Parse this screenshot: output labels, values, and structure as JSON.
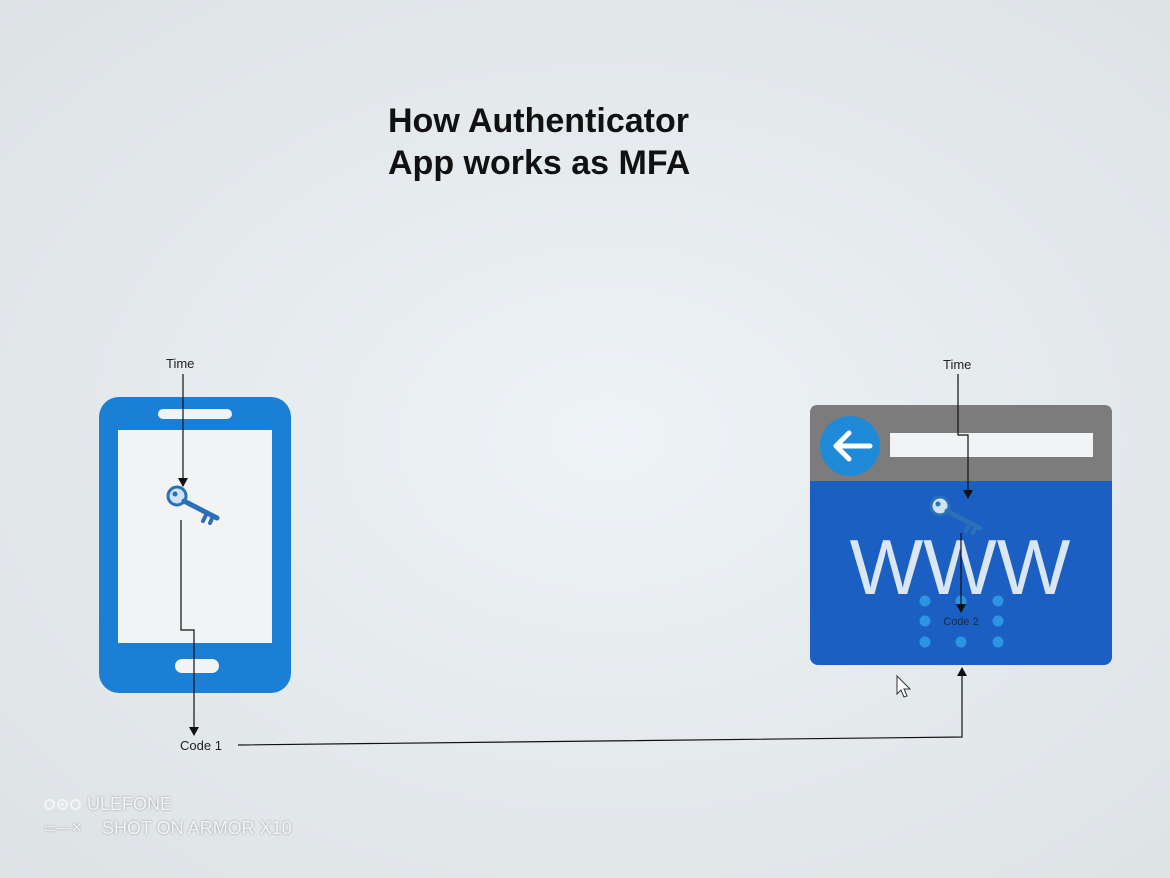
{
  "title": {
    "line1": "How Authenticator",
    "line2": "App works as MFA"
  },
  "phone": {
    "time_label": "Time",
    "code_label": "Code 1",
    "icon": "smartphone-icon",
    "key_icon": "key-icon",
    "color": "#1b7fd6"
  },
  "browser": {
    "time_label": "Time",
    "code_label": "Code 2",
    "www_text": "WWW",
    "back_icon": "arrow-left-icon",
    "key_icon": "key-icon",
    "bar_color": "#7c7c7c",
    "body_color": "#1b5fc2",
    "accent_color": "#1f8ad8"
  },
  "watermark": {
    "brand": "ULEFONE",
    "shot_text": "SHOT ON ARMOR X10"
  }
}
